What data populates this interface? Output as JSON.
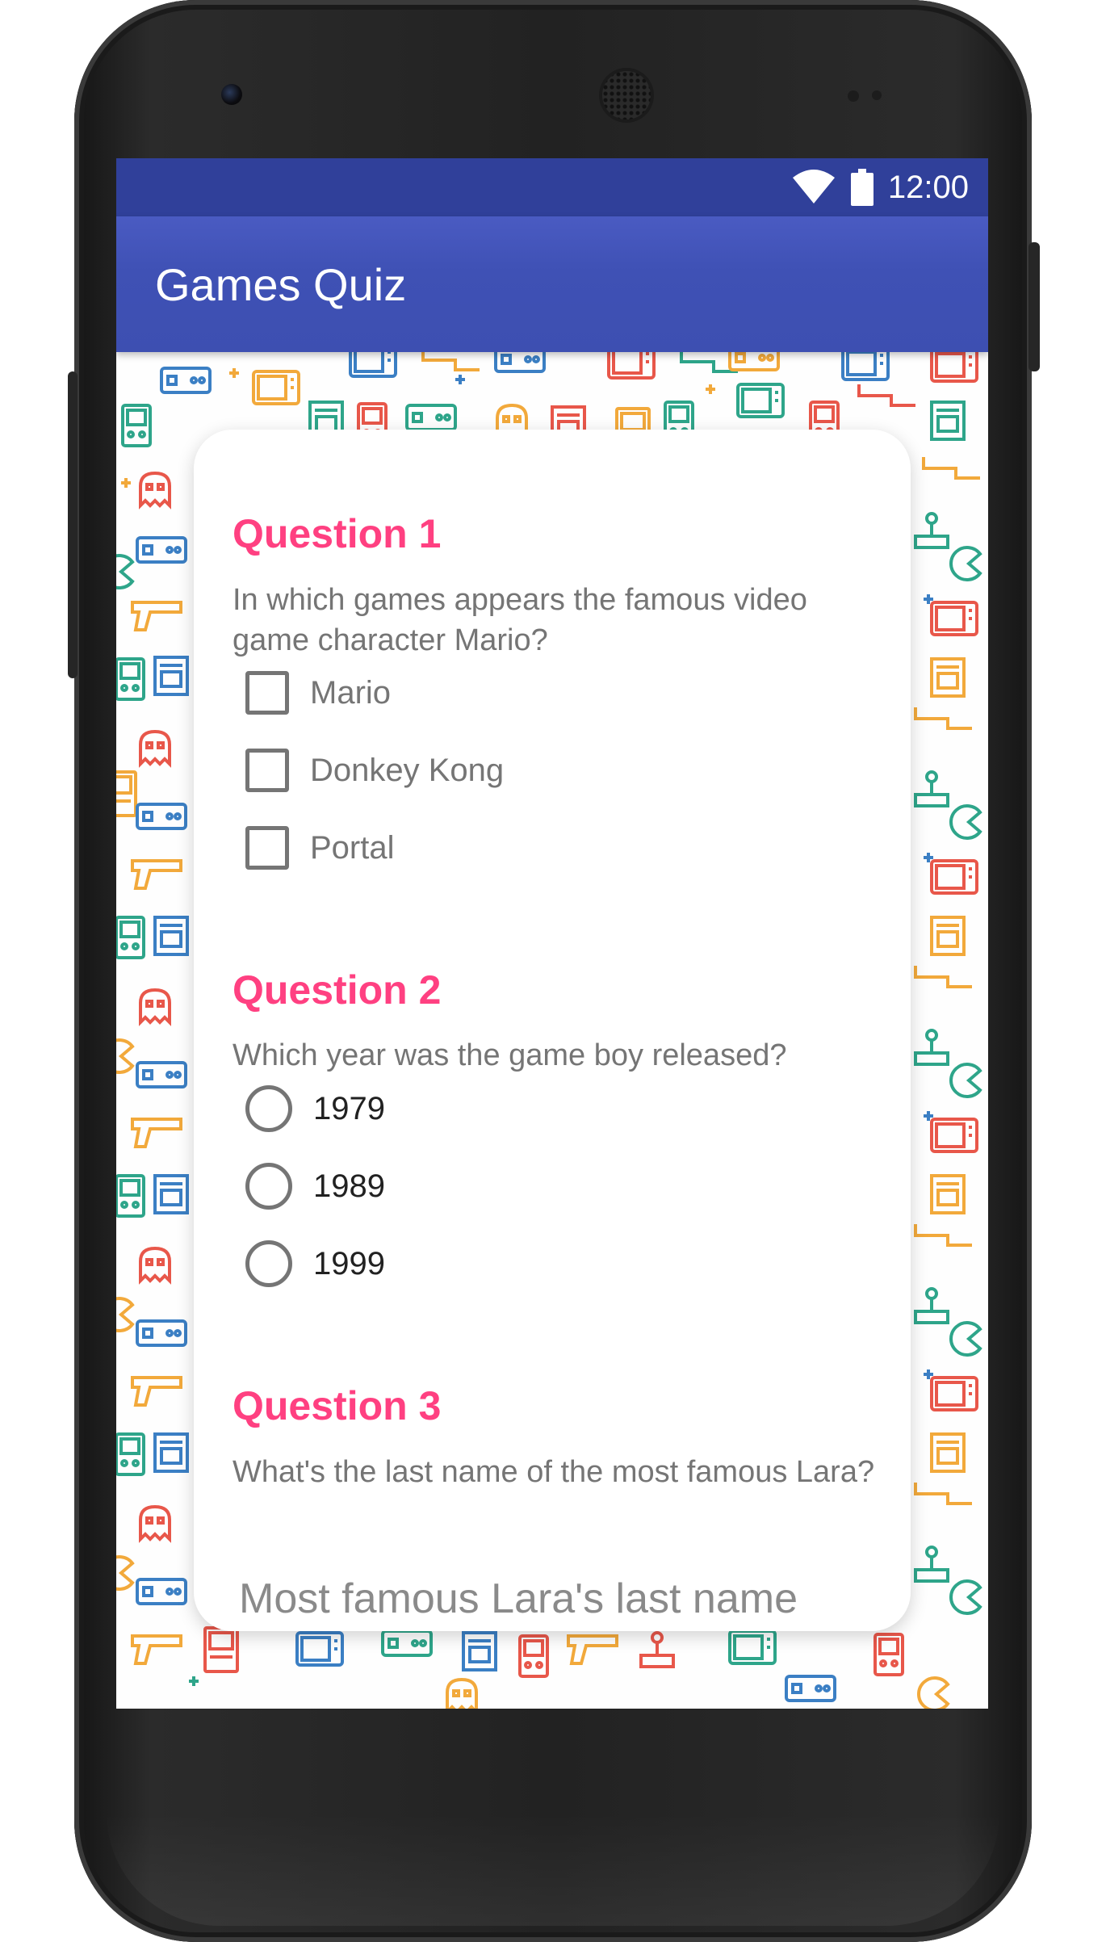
{
  "status_bar": {
    "time": "12:00",
    "icons": [
      "wifi-icon",
      "battery-icon"
    ]
  },
  "app_bar": {
    "title": "Games Quiz",
    "color": "#3f51b5",
    "status_color": "#30409a"
  },
  "theme": {
    "accent": "#ff4081",
    "text_secondary": "#757575",
    "text_primary": "#212121"
  },
  "questions": [
    {
      "heading": "Question 1",
      "text": "In which games appears the famous video game character Mario?",
      "type": "checkbox",
      "options": [
        {
          "label": "Mario",
          "checked": false
        },
        {
          "label": "Donkey Kong",
          "checked": false
        },
        {
          "label": "Portal",
          "checked": false
        }
      ]
    },
    {
      "heading": "Question 2",
      "text": "Which year was the game boy released?",
      "type": "radio",
      "options": [
        {
          "label": "1979",
          "checked": false
        },
        {
          "label": "1989",
          "checked": false
        },
        {
          "label": "1999",
          "checked": false
        }
      ]
    },
    {
      "heading": "Question 3",
      "text": "What's the last name of the most famous Lara?",
      "type": "text",
      "input": {
        "placeholder": "Most famous Lara's last name",
        "value": ""
      }
    }
  ],
  "background_pattern_icons": [
    "handheld-console-icon",
    "game-controller-icon",
    "ghost-icon",
    "joystick-icon",
    "light-gun-icon",
    "cartridge-icon",
    "arcade-cabinet-icon",
    "tv-icon",
    "pacman-icon"
  ],
  "pattern_colors": [
    "#2ea58a",
    "#f2a93b",
    "#e8574a",
    "#3b7fc4"
  ]
}
